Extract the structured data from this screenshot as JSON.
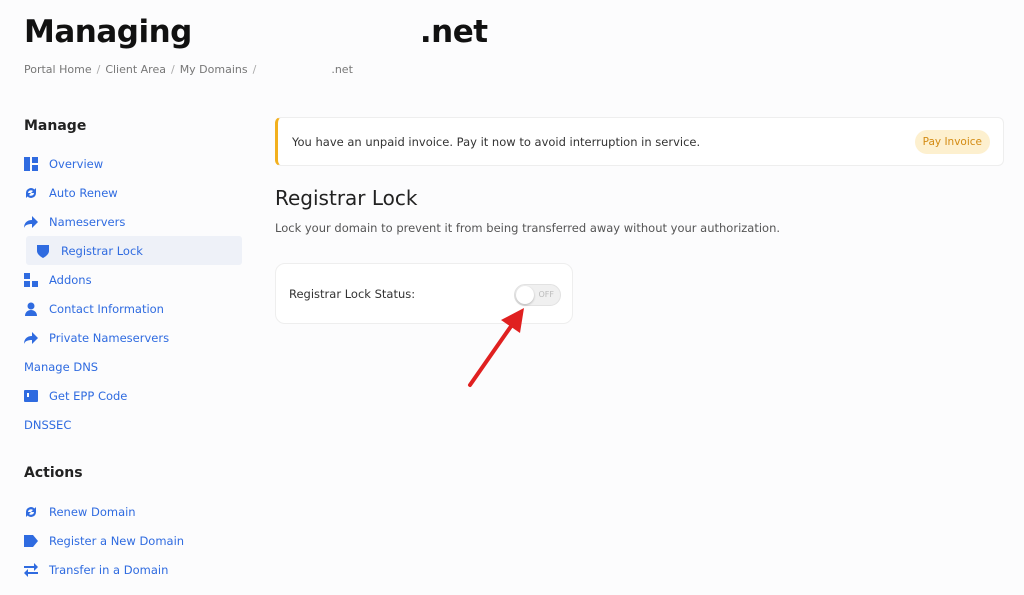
{
  "header": {
    "title_prefix": "Managing",
    "title_suffix": ".net"
  },
  "breadcrumb": {
    "items": [
      "Portal Home",
      "Client Area",
      "My Domains"
    ],
    "current_suffix": ".net"
  },
  "sidebar": {
    "manage_heading": "Manage",
    "manage_items": [
      {
        "label": "Overview",
        "icon": "dashboard-icon"
      },
      {
        "label": "Auto Renew",
        "icon": "sync-icon"
      },
      {
        "label": "Nameservers",
        "icon": "arrow-right-icon"
      },
      {
        "label": "Registrar Lock",
        "icon": "shield-icon",
        "active": true
      },
      {
        "label": "Addons",
        "icon": "cubes-icon"
      },
      {
        "label": "Contact Information",
        "icon": "user-icon"
      },
      {
        "label": "Private Nameservers",
        "icon": "arrow-right-icon"
      },
      {
        "label": "Manage DNS",
        "icon": null
      },
      {
        "label": "Get EPP Code",
        "icon": "code-icon"
      },
      {
        "label": "DNSSEC",
        "icon": null
      }
    ],
    "actions_heading": "Actions",
    "action_items": [
      {
        "label": "Renew Domain",
        "icon": "sync-icon"
      },
      {
        "label": "Register a New Domain",
        "icon": "tag-icon"
      },
      {
        "label": "Transfer in a Domain",
        "icon": "exchange-icon"
      }
    ]
  },
  "alert": {
    "message": "You have an unpaid invoice. Pay it now to avoid interruption in service.",
    "button_label": "Pay Invoice"
  },
  "registrar_lock": {
    "title": "Registrar Lock",
    "description": "Lock your domain to prevent it from being transferred away without your authorization.",
    "status_label": "Registrar Lock Status:",
    "toggle_state": "OFF"
  },
  "colors": {
    "link": "#2f6be0",
    "warning_border": "#f2b01e",
    "pay_button_bg": "#fdf0cf",
    "pay_button_text": "#d38b13",
    "annotation_arrow": "#e02020"
  }
}
